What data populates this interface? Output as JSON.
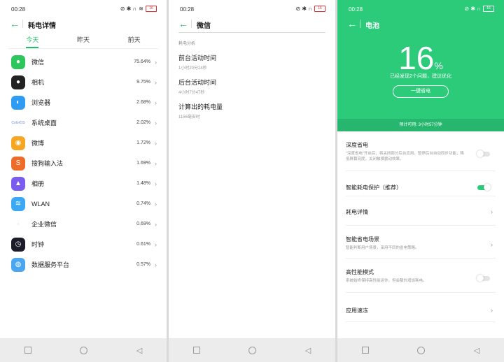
{
  "status": {
    "time": "00:28",
    "signal": "⁴ᴳ.ıll",
    "wifi": "≋",
    "icons": "⊘ ✱ ∩",
    "battery": "16"
  },
  "panel1": {
    "title": "耗电详情",
    "tabs": [
      "今天",
      "昨天",
      "前天"
    ],
    "apps": [
      {
        "name": "微信",
        "pct": "75.64%",
        "color": "#2dc65b",
        "icon": "wechat-icon",
        "glyph": "●"
      },
      {
        "name": "相机",
        "pct": "9.75%",
        "color": "#222222",
        "icon": "camera-icon",
        "glyph": "●"
      },
      {
        "name": "浏览器",
        "pct": "2.68%",
        "color": "#2e9cf2",
        "icon": "browser-icon",
        "glyph": "◐"
      },
      {
        "name": "系统桌面",
        "pct": "2.02%",
        "color": "#ffffff",
        "icon": "launcher-icon",
        "glyph": "ColorOS"
      },
      {
        "name": "微博",
        "pct": "1.72%",
        "color": "#f5a623",
        "icon": "weibo-icon",
        "glyph": "◉"
      },
      {
        "name": "搜狗输入法",
        "pct": "1.69%",
        "color": "#ef6b2a",
        "icon": "sogou-icon",
        "glyph": "S"
      },
      {
        "name": "相册",
        "pct": "1.48%",
        "color": "#7a5cf0",
        "icon": "gallery-icon",
        "glyph": "▲"
      },
      {
        "name": "WLAN",
        "pct": "0.74%",
        "color": "#3aa8f5",
        "icon": "wlan-icon",
        "glyph": "≋"
      },
      {
        "name": "企业微信",
        "pct": "0.69%",
        "color": "#ffffff",
        "icon": "wecom-icon",
        "glyph": "◌"
      },
      {
        "name": "时钟",
        "pct": "0.61%",
        "color": "#1b1b2a",
        "icon": "clock-icon",
        "glyph": "◷"
      },
      {
        "name": "数据服务平台",
        "pct": "0.57%",
        "color": "#4aa6f0",
        "icon": "data-service-icon",
        "glyph": "◍"
      }
    ]
  },
  "panel2": {
    "title": "微信",
    "section": "耗电分析",
    "details": [
      {
        "title": "前台活动时间",
        "sub": "1小时20分24秒"
      },
      {
        "title": "后台活动时间",
        "sub": "4小时7分47秒"
      },
      {
        "title": "计算出的耗电量",
        "sub": "1156毫安时"
      }
    ]
  },
  "panel3": {
    "title": "电池",
    "level": "16",
    "level_unit": "%",
    "hint": "已经发现2个问题，建议优化",
    "button": "一键省电",
    "predict": "预计可用: 3小时57分钟",
    "settings": [
      {
        "title": "深度省电",
        "sub": "\"深度省电\"开启后，将关闭部分后台应用，暂停后台自动同步功能，降低屏幕亮度，关闭触摸震动效果。",
        "control": "toggle",
        "on": false
      },
      {
        "title": "智能耗电保护（推荐）",
        "sub": "",
        "control": "toggle",
        "on": true
      },
      {
        "title": "耗电详情",
        "sub": "",
        "control": "chevron"
      },
      {
        "title": "智能省电场景",
        "sub": "智能判断用户场景，采用不同的省电策略。",
        "control": "chevron"
      },
      {
        "title": "高性能模式",
        "sub": "系统始终保持高性能运作，但会额外增加耗电。",
        "control": "toggle",
        "on": false
      },
      {
        "title": "应用速冻",
        "sub": "",
        "control": "chevron"
      }
    ]
  },
  "nav": {
    "recent": "□",
    "home": "○",
    "back": "◁"
  }
}
